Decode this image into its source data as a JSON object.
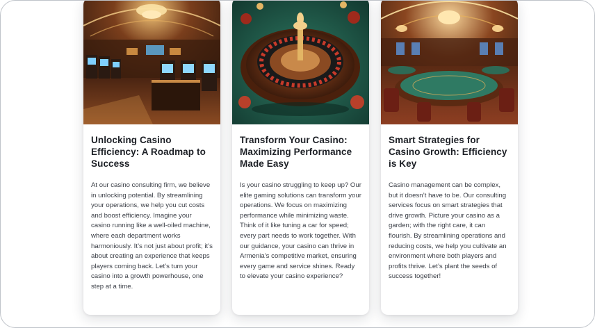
{
  "cards": [
    {
      "image": "casino-slot-machine-hall",
      "title": "Unlocking Casino Efficiency: A Roadmap to Success",
      "text": "At our casino consulting firm, we believe in unlocking potential. By streamlining your operations, we help you cut costs and boost efficiency. Imagine your casino running like a well-oiled machine, where each department works harmoniously. It’s not just about profit; it’s about creating an experience that keeps players coming back. Let’s turn your casino into a growth powerhouse, one step at a time."
    },
    {
      "image": "roulette-wheel-table",
      "title": "Transform Your Casino: Maximizing Performance Made Easy",
      "text": "Is your casino struggling to keep up? Our elite gaming solutions can transform your operations. We focus on maximizing performance while minimizing waste. Think of it like tuning a car for speed; every part needs to work together. With our guidance, your casino can thrive in Armenia’s competitive market, ensuring every game and service shines. Ready to elevate your casino experience?"
    },
    {
      "image": "casino-gaming-tables-hall",
      "title": "Smart Strategies for Casino Growth: Efficiency is Key",
      "text": "Casino management can be complex, but it doesn’t have to be. Our consulting services focus on smart strategies that drive growth. Picture your casino as a garden; with the right care, it can flourish. By streamlining operations and reducing costs, we help you cultivate an environment where both players and profits thrive. Let’s plant the seeds of success together!"
    }
  ],
  "colors": {
    "title": "#1d2026",
    "text": "#3a3e46",
    "frame_border": "#bfc3c9",
    "felt_green": "#1f5a4a",
    "wood": "#5a2c14",
    "gold": "#e8b25a"
  }
}
